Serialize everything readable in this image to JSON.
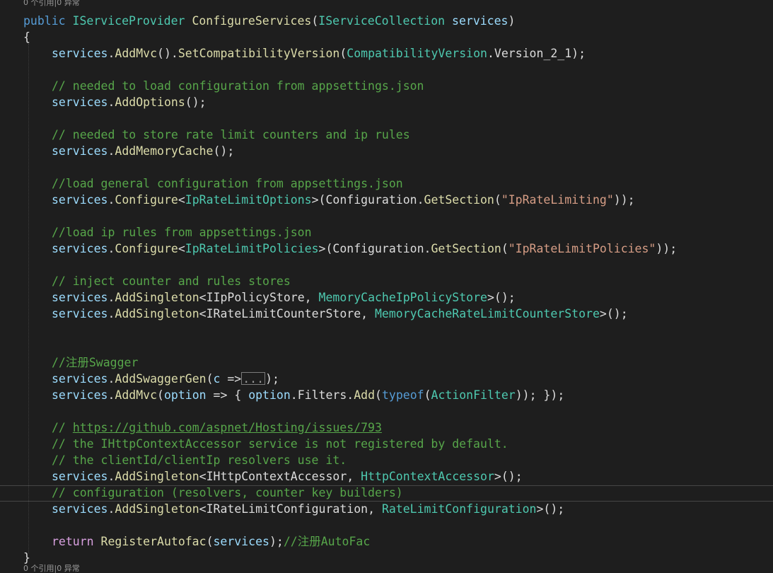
{
  "codelens": {
    "top_text": "0 个引用|0 异常",
    "bottom_text": "0 个引用|0 异常"
  },
  "code": {
    "sig_public": "public",
    "sig_return_type": "IServiceProvider",
    "sig_method": "ConfigureServices",
    "sig_param_type": "IServiceCollection",
    "sig_param_name": "services",
    "open_brace": "{",
    "close_brace": "}",
    "services": "services",
    "add_mvc": "AddMvc",
    "set_compat": "SetCompatibilityVersion",
    "compat_type": "CompatibilityVersion",
    "compat_version": "Version_2_1",
    "comment_options": "// needed to load configuration from appsettings.json",
    "add_options": "AddOptions",
    "comment_cache": "// needed to store rate limit counters and ip rules",
    "add_memory_cache": "AddMemoryCache",
    "comment_general": "//load general configuration from appsettings.json",
    "configure": "Configure",
    "ip_rate_limit_options": "IpRateLimitOptions",
    "configuration": "Configuration",
    "get_section": "GetSection",
    "str_ip_rate_limiting": "\"IpRateLimiting\"",
    "comment_ip_rules": "//load ip rules from appsettings.json",
    "ip_rate_limit_policies": "IpRateLimitPolicies",
    "str_ip_rate_limit_policies": "\"IpRateLimitPolicies\"",
    "comment_inject": "// inject counter and rules stores",
    "add_singleton": "AddSingleton",
    "iip_policy_store": "IIpPolicyStore",
    "memory_cache_ip_policy_store": "MemoryCacheIpPolicyStore",
    "irate_limit_counter_store": "IRateLimitCounterStore",
    "memory_cache_rate_limit_counter_store": "MemoryCacheRateLimitCounterStore",
    "comment_swagger": "//注册Swagger",
    "add_swagger_gen": "AddSwaggerGen",
    "param_c": "c",
    "collapsed": "...",
    "param_option": "option",
    "filters": "Filters",
    "add": "Add",
    "typeof_kw": "typeof",
    "action_filter": "ActionFilter",
    "comment_link_prefix": "// ",
    "link_url": "https://github.com/aspnet/Hosting/issues/793",
    "comment_http1": "// the IHttpContextAccessor service is not registered by default.",
    "comment_http2": "// the clientId/clientIp resolvers use it.",
    "ihttp_context_accessor": "IHttpContextAccessor",
    "http_context_accessor": "HttpContextAccessor",
    "comment_configuration": "// configuration (resolvers, counter key builders)",
    "irate_limit_configuration": "IRateLimitConfiguration",
    "rate_limit_configuration": "RateLimitConfiguration",
    "return_kw": "return",
    "register_autofac": "RegisterAutofac",
    "comment_autofac": "//注册AutoFac"
  },
  "colors": {
    "background": "#1e1e1e",
    "keyword": "#569cd6",
    "type": "#4ec9b0",
    "method": "#dcdcaa",
    "parameter": "#9cdcfe",
    "string": "#d69d85",
    "comment": "#57a64a",
    "control_keyword": "#d8a0df",
    "plain": "#dcdcdc"
  }
}
